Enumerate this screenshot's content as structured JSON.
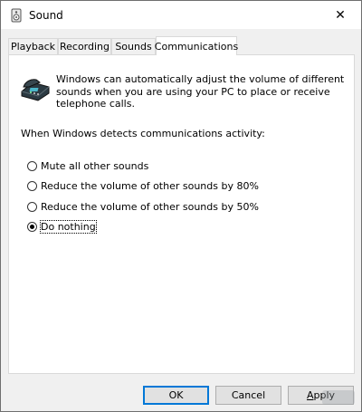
{
  "window": {
    "title": "Sound",
    "close_glyph": "✕"
  },
  "tabs": [
    {
      "label": "Playback",
      "active": false
    },
    {
      "label": "Recording",
      "active": false
    },
    {
      "label": "Sounds",
      "active": false
    },
    {
      "label": "Communications",
      "active": true
    }
  ],
  "communications": {
    "description": "Windows can automatically adjust the volume of different sounds when you are using your PC to place or receive telephone calls.",
    "prompt": "When Windows detects communications activity:",
    "options": [
      {
        "label": "Mute all other sounds",
        "checked": false
      },
      {
        "label": "Reduce the volume of other sounds by 80%",
        "checked": false
      },
      {
        "label": "Reduce the volume of other sounds by 50%",
        "checked": false
      },
      {
        "label": "Do nothing",
        "checked": true
      }
    ]
  },
  "buttons": {
    "ok": "OK",
    "cancel": "Cancel",
    "apply_accel": "A",
    "apply_rest": "pply"
  },
  "colors": {
    "accent": "#0078d7",
    "dialog_bg": "#f0f0f0",
    "panel_bg": "#ffffff"
  }
}
